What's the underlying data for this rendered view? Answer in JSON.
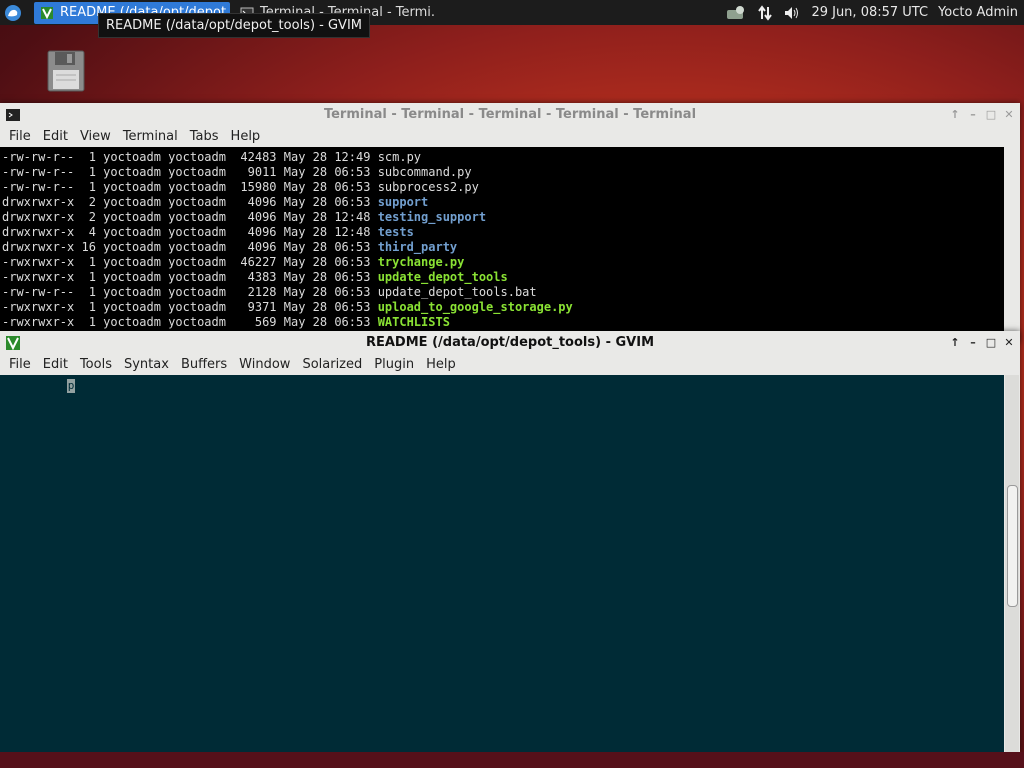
{
  "panel": {
    "tasks": [
      {
        "label": "README (/data/opt/depot...",
        "icon": "vim-icon",
        "active": true
      },
      {
        "label": "Terminal - Terminal - Termi...",
        "icon": "terminal-icon",
        "active": false
      }
    ],
    "datetime": "29 Jun, 08:57 UTC",
    "user": "Yocto Admin",
    "tray_icons": [
      "applet-icon",
      "network-icon",
      "volume-icon"
    ]
  },
  "tooltip": "README (/data/opt/depot_tools) - GVIM",
  "terminal": {
    "title": "Terminal - Terminal - Terminal - Terminal - Terminal",
    "menu": [
      "File",
      "Edit",
      "View",
      "Terminal",
      "Tabs",
      "Help"
    ],
    "lines": [
      {
        "info": "-rw-rw-r--  1 yoctoadm yoctoadm  42483 May 28 12:49 ",
        "name": "scm.py",
        "type": "plain"
      },
      {
        "info": "-rw-rw-r--  1 yoctoadm yoctoadm   9011 May 28 06:53 ",
        "name": "subcommand.py",
        "type": "plain"
      },
      {
        "info": "-rw-rw-r--  1 yoctoadm yoctoadm  15980 May 28 06:53 ",
        "name": "subprocess2.py",
        "type": "plain"
      },
      {
        "info": "drwxrwxr-x  2 yoctoadm yoctoadm   4096 May 28 06:53 ",
        "name": "support",
        "type": "dir"
      },
      {
        "info": "drwxrwxr-x  2 yoctoadm yoctoadm   4096 May 28 12:48 ",
        "name": "testing_support",
        "type": "dir"
      },
      {
        "info": "drwxrwxr-x  4 yoctoadm yoctoadm   4096 May 28 12:48 ",
        "name": "tests",
        "type": "dir"
      },
      {
        "info": "drwxrwxr-x 16 yoctoadm yoctoadm   4096 May 28 06:53 ",
        "name": "third_party",
        "type": "dir"
      },
      {
        "info": "-rwxrwxr-x  1 yoctoadm yoctoadm  46227 May 28 06:53 ",
        "name": "trychange.py",
        "type": "exec"
      },
      {
        "info": "-rwxrwxr-x  1 yoctoadm yoctoadm   4383 May 28 06:53 ",
        "name": "update_depot_tools",
        "type": "exec"
      },
      {
        "info": "-rw-rw-r--  1 yoctoadm yoctoadm   2128 May 28 06:53 ",
        "name": "update_depot_tools.bat",
        "type": "plain"
      },
      {
        "info": "-rwxrwxr-x  1 yoctoadm yoctoadm   9371 May 28 06:53 ",
        "name": "upload_to_google_storage.py",
        "type": "exec"
      },
      {
        "info": "-rwxrwxr-x  1 yoctoadm yoctoadm    569 May 28 06:53 ",
        "name": "WATCHLISTS",
        "type": "exec"
      }
    ]
  },
  "gvim": {
    "title": "README (/data/opt/depot_tools) - GVIM",
    "menu": [
      "File",
      "Edit",
      "Tools",
      "Syntax",
      "Buffers",
      "Window",
      "Solarized",
      "Plugin",
      "Help"
    ],
    "cursor_char": "p",
    "colors": {
      "background": "#002b36"
    }
  },
  "window_buttons": [
    "↑",
    "–",
    "□",
    "✕"
  ]
}
